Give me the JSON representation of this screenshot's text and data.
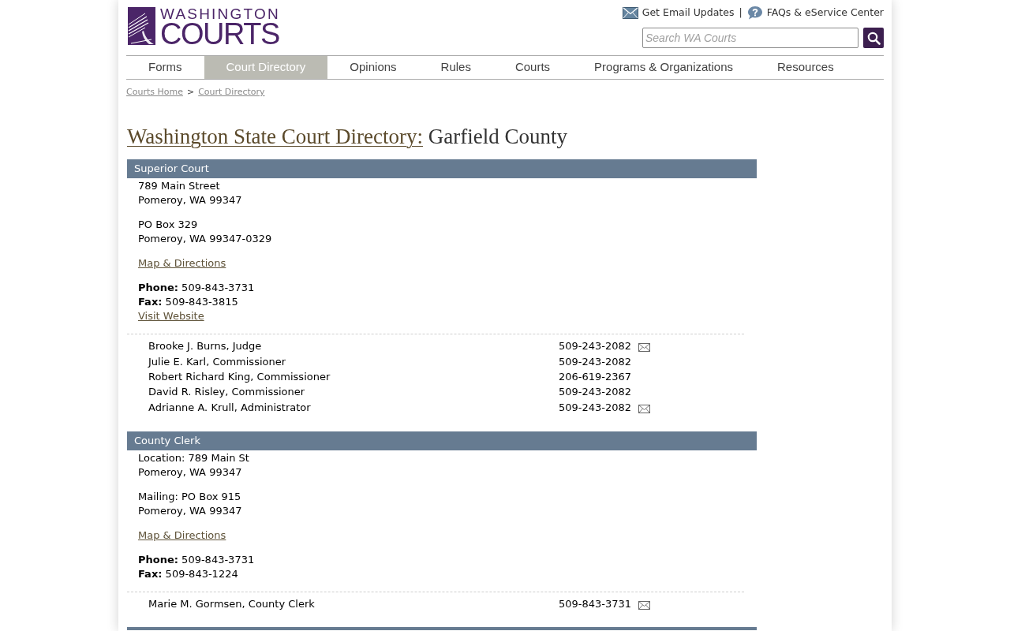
{
  "header": {
    "logo": {
      "line1": "WASHINGTON",
      "line2": "COURTS"
    },
    "utility_links": [
      {
        "kind": "email",
        "label": "Get Email Updates"
      },
      {
        "kind": "help",
        "label": "FAQs & eService Center"
      }
    ],
    "link_separator": "|",
    "search": {
      "placeholder": "Search WA Courts"
    }
  },
  "nav": [
    {
      "label": "Forms",
      "selected": false
    },
    {
      "label": "Court Directory",
      "selected": true
    },
    {
      "label": "Opinions",
      "selected": false
    },
    {
      "label": "Rules",
      "selected": false
    },
    {
      "label": "Courts",
      "selected": false
    },
    {
      "label": "Programs & Organizations",
      "selected": false
    },
    {
      "label": "Resources",
      "selected": false
    }
  ],
  "breadcrumbs": {
    "links": [
      "Courts Home",
      "Court Directory"
    ],
    "separator": ">"
  },
  "heading": {
    "link": "Washington State Court Directory:",
    "county": "Garfield County"
  },
  "sections": [
    {
      "title": "Superior Court",
      "addresses": [
        [
          "789 Main Street",
          "Pomeroy, WA 99347"
        ],
        [
          "PO Box 329",
          "Pomeroy, WA 99347-0329"
        ]
      ],
      "map_link": "Map & Directions",
      "phone": "**Phone:** 509-843-3731",
      "fax": "**Fax:** 509-843-3815",
      "website_link": "Visit Website",
      "contacts": [
        {
          "name": "Brooke J. Burns, Judge",
          "phone": "509-243-2082",
          "email": true
        },
        {
          "name": "Julie E. Karl, Commissioner",
          "phone": "509-243-2082",
          "email": false
        },
        {
          "name": "Robert Richard King, Commissioner",
          "phone": "206-619-2367",
          "email": false
        },
        {
          "name": "David R. Risley, Commissioner",
          "phone": "509-243-2082",
          "email": false
        },
        {
          "name": "Adrianne A. Krull, Administrator",
          "phone": "509-243-2082",
          "email": true
        }
      ]
    },
    {
      "title": "County Clerk",
      "addresses": [
        [
          "Location: 789 Main St",
          "Pomeroy, WA 99347"
        ],
        [
          "Mailing: PO Box 915",
          "Pomeroy, WA 99347"
        ]
      ],
      "map_link": "Map & Directions",
      "phone": "**Phone:** 509-843-3731",
      "fax": "**Fax:** 509-843-1224",
      "contacts": [
        {
          "name": "Marie M. Gormsen, County Clerk",
          "phone": "509-843-3731",
          "email": true
        }
      ]
    }
  ]
}
